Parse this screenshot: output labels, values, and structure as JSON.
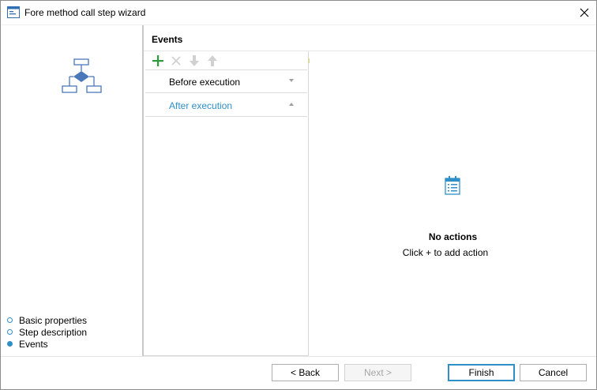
{
  "window": {
    "title": "Fore method call step wizard"
  },
  "steps": [
    {
      "label": "Basic properties",
      "current": false
    },
    {
      "label": "Step description",
      "current": false
    },
    {
      "label": "Events",
      "current": true
    }
  ],
  "section": {
    "title": "Events"
  },
  "events": [
    {
      "label": "Before execution",
      "expanded": false,
      "selected": false
    },
    {
      "label": "After execution",
      "expanded": true,
      "selected": true
    }
  ],
  "empty_state": {
    "title": "No actions",
    "hint": "Click + to add action"
  },
  "footer": {
    "back": "< Back",
    "next": "Next >",
    "finish": "Finish",
    "cancel": "Cancel"
  },
  "colors": {
    "accent": "#2f8fc9",
    "add_green": "#2e9b3c",
    "graphic_blue": "#4a78b8"
  }
}
